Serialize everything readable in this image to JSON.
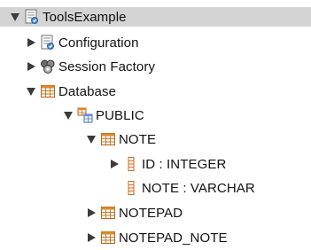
{
  "tree": {
    "root": {
      "label": "ToolsExample",
      "expanded": true,
      "icon": "console-config-icon"
    },
    "configuration": {
      "label": "Configuration",
      "expanded": false,
      "icon": "configuration-icon"
    },
    "session_factory": {
      "label": "Session Factory",
      "expanded": false,
      "icon": "session-factory-icon"
    },
    "database": {
      "label": "Database",
      "expanded": true,
      "icon": "database-table-icon"
    },
    "schema_public": {
      "label": "PUBLIC",
      "expanded": true,
      "icon": "schema-icon"
    },
    "table_note": {
      "label": "NOTE",
      "expanded": true,
      "icon": "table-icon"
    },
    "column_id": {
      "label": "ID : INTEGER",
      "expanded": false,
      "icon": "primary-key-column-icon"
    },
    "column_note": {
      "label": "NOTE : VARCHAR",
      "icon": "column-icon"
    },
    "table_notepad": {
      "label": "NOTEPAD",
      "expanded": false,
      "icon": "table-icon"
    },
    "table_notepad_note": {
      "label": "NOTEPAD_NOTE",
      "expanded": false,
      "icon": "table-icon"
    }
  },
  "colors": {
    "selection": "#d4d4d4",
    "table_icon_border": "#b5651d",
    "table_icon_header": "#e08a2b",
    "column_icon": "#d2691e",
    "twisty": "#3b3b3b"
  }
}
